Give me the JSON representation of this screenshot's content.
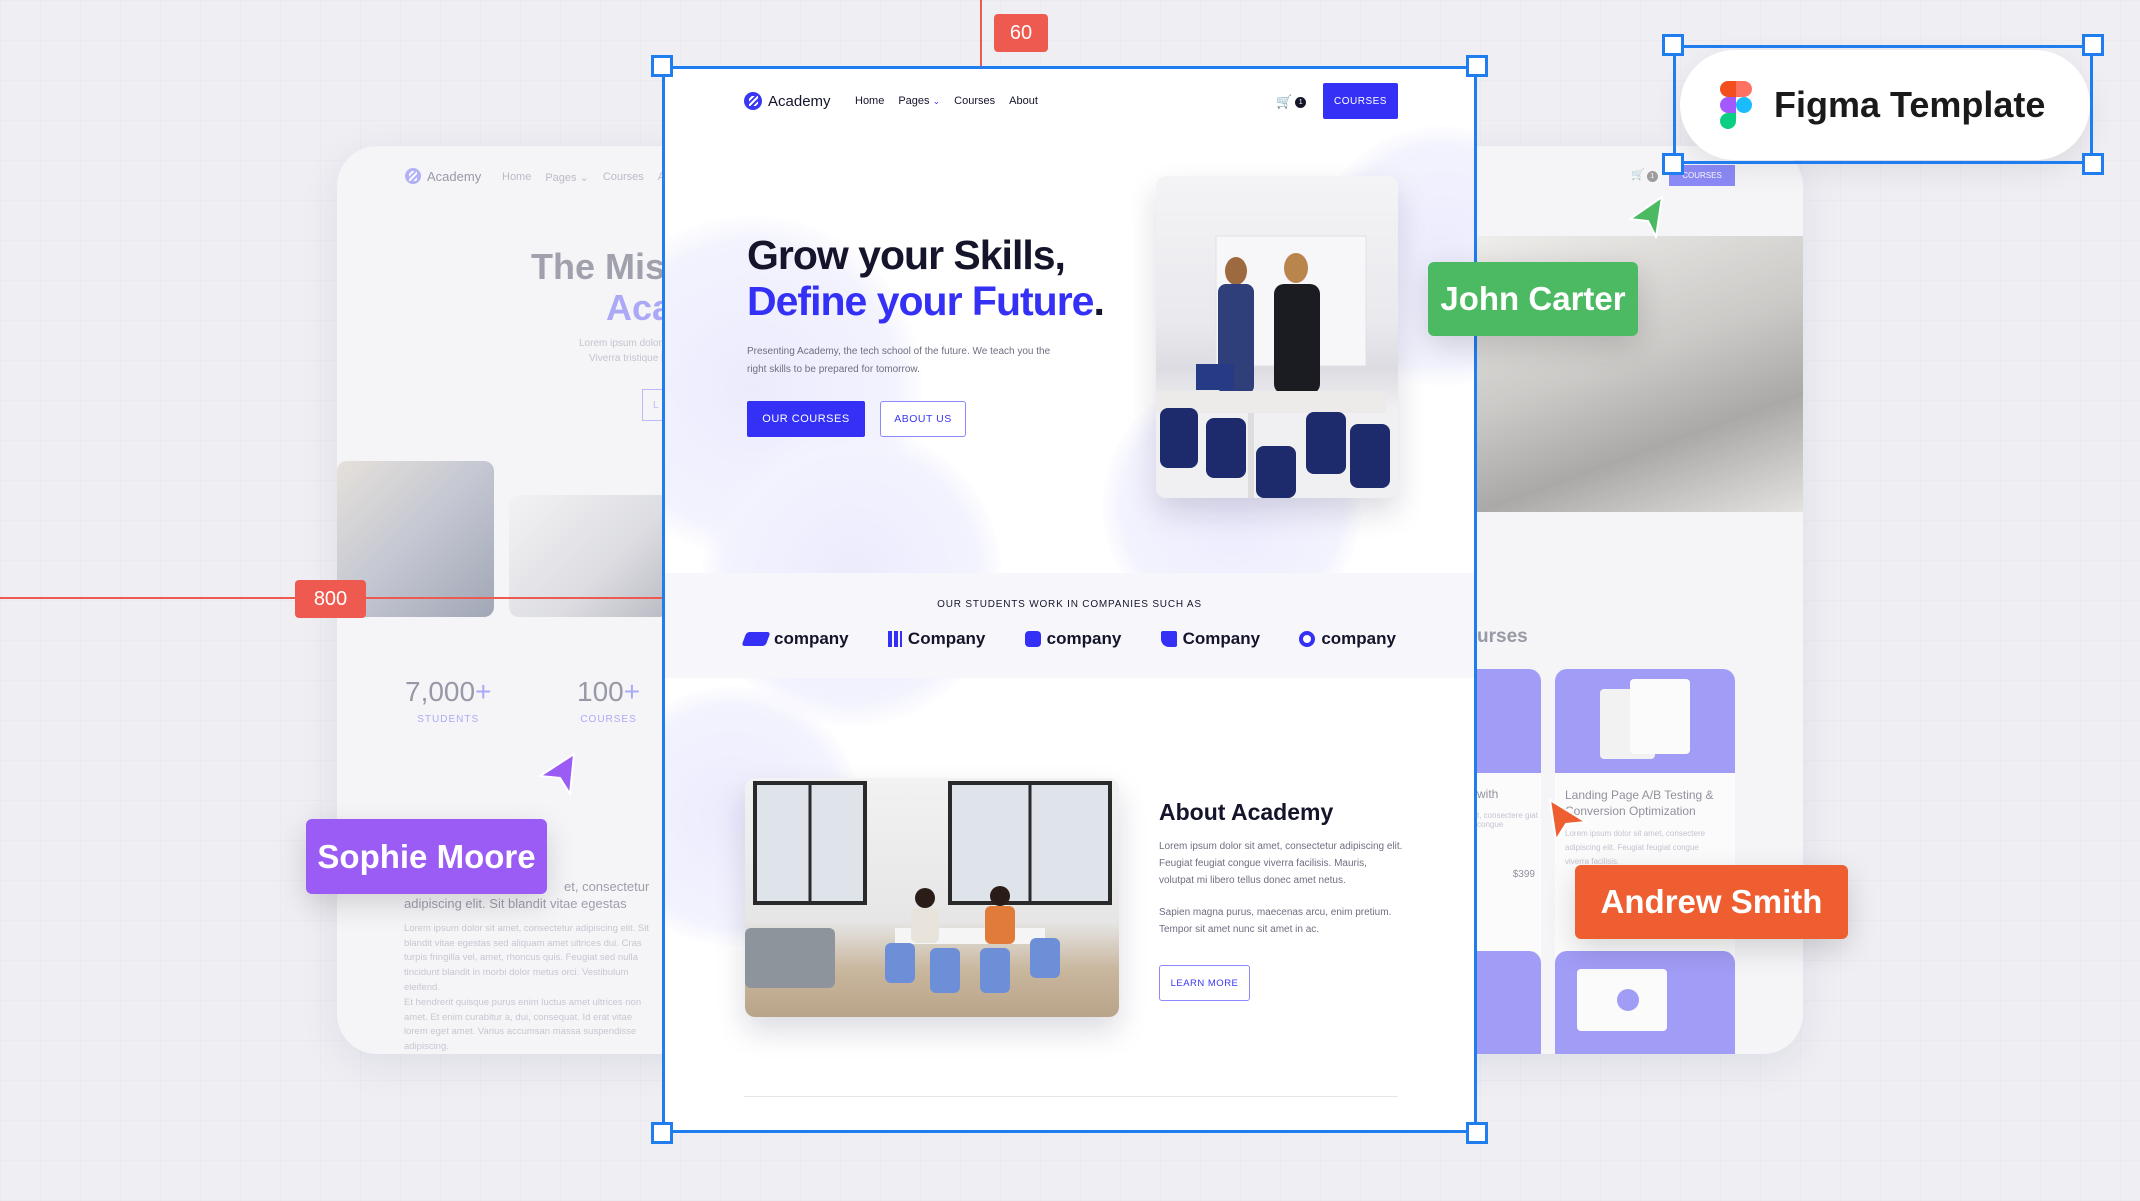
{
  "canvas_markers": {
    "top_ruler": "60",
    "left_ruler": "800"
  },
  "figma_badge": {
    "label": "Figma Template"
  },
  "collaborators": [
    {
      "name": "John Carter",
      "color": "#4cb963"
    },
    {
      "name": "Sophie Moore",
      "color": "#9b5cf5"
    },
    {
      "name": "Andrew Smith",
      "color": "#ee5e30"
    }
  ],
  "brand": {
    "name": "Academy",
    "accent": "#3430f5",
    "dark": "#14142b"
  },
  "nav": {
    "items": [
      "Home",
      "Pages",
      "Courses",
      "About"
    ],
    "cart_count": "1",
    "cta": "COURSES"
  },
  "hero": {
    "title_line1": "Grow your Skills,",
    "title_line2": "Define your Future",
    "title_period": ".",
    "subtitle_line1": "Presenting Academy, the tech school of the future. We teach you the",
    "subtitle_line2": "right skills to be prepared for tomorrow.",
    "primary_button": "OUR COURSES",
    "secondary_button": "ABOUT US"
  },
  "companies": {
    "heading": "OUR STUDENTS WORK IN COMPANIES SUCH AS",
    "logos": [
      "company",
      "Company",
      "company",
      "Company",
      "company"
    ]
  },
  "about": {
    "title": "About Academy",
    "para1": "Lorem ipsum dolor sit amet, consectetur adipiscing elit. Feugiat feugiat congue viverra facilisis. Mauris, volutpat mi libero tellus donec amet netus.",
    "para2": "Sapien magna purus, maecenas arcu, enim pretium. Tempor sit amet nunc sit amet in ac.",
    "button": "LEARN MORE"
  },
  "back_left": {
    "title_line1": "The Miss",
    "title_line2": "Aca",
    "sub_line1": "Lorem ipsum dolor si",
    "sub_line2": "Viverra tristique la",
    "button": "L",
    "stats": [
      {
        "value": "7,000",
        "plus": "+",
        "label": "STUDENTS"
      },
      {
        "value": "100",
        "plus": "+",
        "label": "COURSES"
      }
    ],
    "lead": "et, consectetur adipiscing elit. Sit blandit vitae egestas",
    "body1": "Lorem ipsum dolor sit amet, consectetur adipiscing elit. Sit blandit vitae egestas sed aliquam amet ultrices dui. Cras turpis fringilla vel, amet, rhoncus quis. Feugiat sed nulla tincidunt blandit in morbi dolor metus orci. Vestibulum eleifend.",
    "body2": "Et hendrerit quisque purus enim luctus amet ultrices non amet. Et enim curabitur a, dui, consequat. Id erat vitae lorem eget amet. Varius accumsan massa suspendisse adipiscing."
  },
  "back_right": {
    "cart_count": "1",
    "cta": "COURSES",
    "section_title": "urses",
    "card1": {
      "title": "with",
      "desc": "t, consectere giat congue",
      "price": "$399"
    },
    "card2": {
      "title": "Landing Page A/B Testing & Conversion Optimization",
      "desc": "Lorem ipsum dolor sit amet, consectere adipiscing elit. Feugiat feugiat congue viverra facilisis."
    }
  }
}
